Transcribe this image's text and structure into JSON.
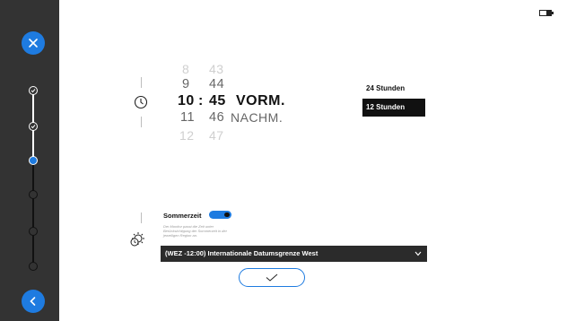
{
  "sidebar": {
    "close_icon": "close-icon",
    "back_icon": "chevron-left-icon",
    "accent": "#1e7be0",
    "steps": [
      {
        "state": "done"
      },
      {
        "state": "done"
      },
      {
        "state": "active"
      },
      {
        "state": "pending"
      },
      {
        "state": "pending"
      },
      {
        "state": "pending"
      }
    ]
  },
  "status": {
    "battery_icon": "battery-icon"
  },
  "time_picker": {
    "hours": [
      "8",
      "9",
      "10",
      "11",
      "12"
    ],
    "minutes": [
      "43",
      "44",
      "45",
      "46",
      "47"
    ],
    "separator": ":",
    "period_selected": "VORM.",
    "period_other": "NACHM."
  },
  "format": {
    "option_24": "24 Stunden",
    "option_12": "12 Stunden",
    "selected": "12 Stunden"
  },
  "dst": {
    "label": "Sommerzeit",
    "enabled": true,
    "description": "Der Monitor passt die Zeit unter Berücksichtigung der Sommerzeit in der jeweiligen Region an."
  },
  "timezone": {
    "value": "(WEZ -12:00) Internationale Datumsgrenze West"
  },
  "confirm": {
    "icon": "check-icon"
  }
}
